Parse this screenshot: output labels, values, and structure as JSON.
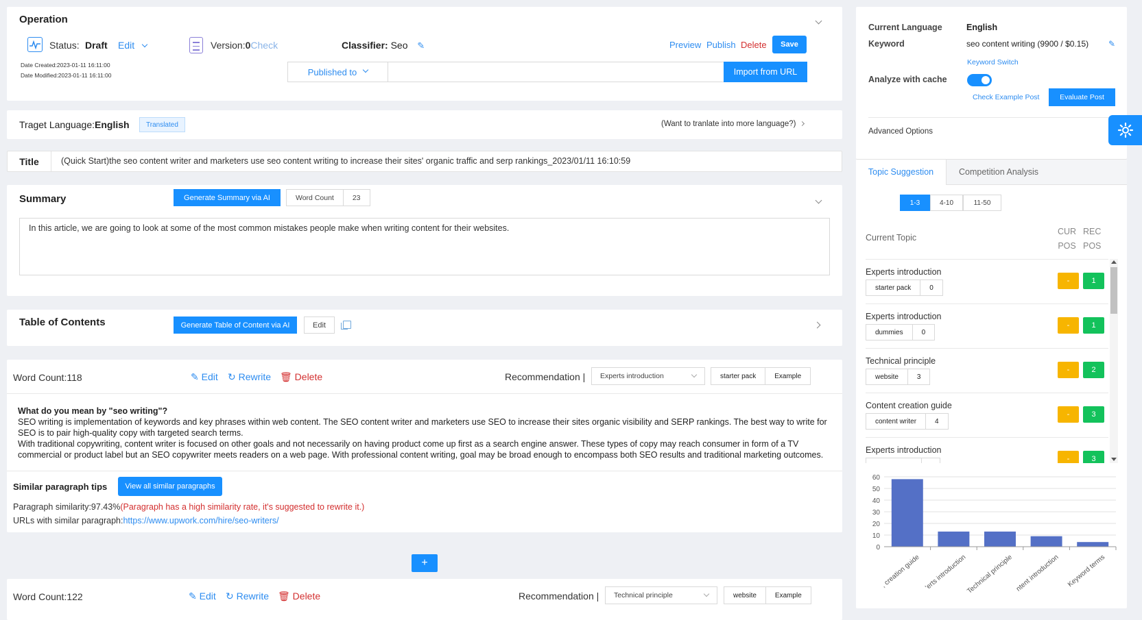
{
  "operation": {
    "title": "Operation",
    "status_label": "Status:",
    "status_value": "Draft",
    "edit_label": "Edit",
    "version_label": "Version:",
    "version_value": "0",
    "check_label": "Check",
    "classifier_label": "Classifier:",
    "classifier_value": "Seo",
    "date_created": "Date Created:2023-01-11 16:11:00",
    "date_modified": "Date Modified:2023-01-11 16:11:00",
    "preview": "Preview",
    "publish": "Publish",
    "delete": "Delete",
    "save": "Save",
    "published_to": "Published to",
    "url_value": "",
    "import_url": "Import from URL"
  },
  "target_language": {
    "label": "Traget Language:",
    "value": "English",
    "badge": "Translated",
    "more": "(Want to tranlate into more language?)"
  },
  "title_row": {
    "label": "Title",
    "value": "(Quick Start)the seo content writer and marketers use seo content writing to increase their sites' organic traffic and serp rankings_2023/01/11 16:10:59"
  },
  "summary": {
    "title": "Summary",
    "generate": "Generate Summary via AI",
    "word_count_label": "Word Count",
    "word_count_value": "23",
    "text": "In this article, we are going to look at some of the most common mistakes people make when writing content for their websites."
  },
  "toc": {
    "title": "Table of Contents",
    "generate": "Generate Table of Content via AI",
    "edit": "Edit"
  },
  "paragraphs": [
    {
      "word_count": "Word Count:118",
      "edit": "Edit",
      "rewrite": "Rewrite",
      "delete": "Delete",
      "recommendation_label": "Recommendation |",
      "recommendation_value": "Experts introduction",
      "tag": "starter pack",
      "example": "Example",
      "heading": "What do you mean by \"seo writing\"?",
      "body1": "SEO writing is implementation of keywords and key phrases within web content. The SEO content writer and marketers use SEO to increase their sites organic visibility and SERP rankings. The best way to write for SEO is to pair high-quality copy with targeted search terms.",
      "body2": "With traditional copywriting, content writer is focused on other goals and not necessarily on having product come up first as a search engine answer. These types of copy may reach consumer in form of a TV commercial or product label but an SEO copywriter meets readers on a web page. With professional content writing, goal may be broad enough to encompass both SEO results and traditional marketing outcomes.",
      "similar_title": "Similar paragraph tips",
      "view_all": "View all similar paragraphs",
      "similarity_label": "Paragraph similarity:97.43%",
      "similarity_warning": "(Paragraph has a high similarity rate, it's suggested to rewrite it.)",
      "urls_label": "URLs with similar paragraph:",
      "url": "https://www.upwork.com/hire/seo-writers/"
    },
    {
      "word_count": "Word Count:122",
      "edit": "Edit",
      "rewrite": "Rewrite",
      "delete": "Delete",
      "recommendation_label": "Recommendation |",
      "recommendation_value": "Technical principle",
      "tag": "website",
      "example": "Example"
    }
  ],
  "add_button": "+",
  "side": {
    "current_language_label": "Current Language",
    "current_language_value": "English",
    "keyword_label": "Keyword",
    "keyword_value": "seo content writing (9900 / $0.15)",
    "keyword_switch": "Keyword Switch",
    "analyze_cache": "Analyze with cache",
    "check_example": "Check Example Post",
    "evaluate": "Evaluate Post",
    "advanced": "Advanced Options",
    "tab_topic": "Topic Suggestion",
    "tab_competition": "Competition Analysis",
    "ranges": [
      "1-3",
      "4-10",
      "11-50"
    ],
    "current_topic": "Current Topic",
    "cur_pos_1": "CUR",
    "cur_pos_2": "POS",
    "rec_pos_1": "REC",
    "rec_pos_2": "POS",
    "topics": [
      {
        "name": "Experts introduction",
        "tag": "starter pack",
        "count": "0",
        "cur": "-",
        "rec": "1"
      },
      {
        "name": "Experts introduction",
        "tag": "dummies",
        "count": "0",
        "cur": "-",
        "rec": "1"
      },
      {
        "name": "Technical principle",
        "tag": "website",
        "count": "3",
        "cur": "-",
        "rec": "2"
      },
      {
        "name": "Content creation guide",
        "tag": "content writer",
        "count": "4",
        "cur": "-",
        "rec": "3"
      },
      {
        "name": "Experts introduction",
        "tag": "",
        "count": "",
        "cur": "-",
        "rec": "3"
      }
    ]
  },
  "chart_data": {
    "type": "bar",
    "categories": [
      "Content creation guide",
      "Experts introduction",
      "Technical principle",
      "Content introduction",
      "Keyword terms"
    ],
    "tick_labels": [
      ", creation guide",
      "'erts introduction",
      "Technical principle",
      "ntent introduction",
      "Keyword terms"
    ],
    "values": [
      58,
      13,
      13,
      9,
      4
    ],
    "ylim": [
      0,
      60
    ],
    "yticks": [
      0,
      10,
      20,
      30,
      40,
      50,
      60
    ],
    "grid": true,
    "bar_color": "#5470c6"
  },
  "colors": {
    "accent": "#1890ff",
    "link": "#2d8cf0",
    "danger": "#d32f2f",
    "cur_pos": "#f7b500",
    "rec_pos": "#13c25b"
  }
}
